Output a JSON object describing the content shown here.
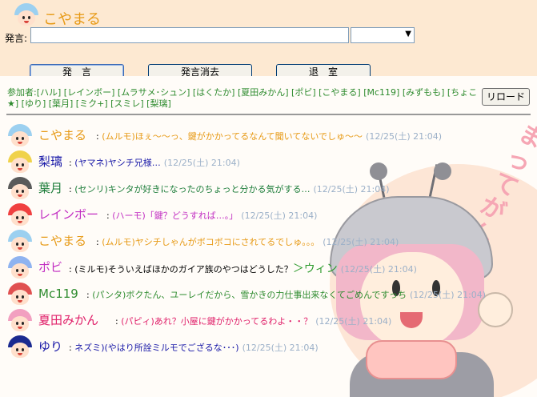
{
  "header": {
    "username": "こやまる",
    "say_label": "発言:",
    "say_input_value": "",
    "color_select_value": ""
  },
  "buttons": {
    "send": "発　言",
    "clear": "発言消去",
    "leave": "退　室",
    "reload": "リロード"
  },
  "participants": {
    "text": "参加者:[ハル] [レインボー] [ムラサメ･シュン] [はくたか] [夏田みかん] [ポビ] [こやまる] [Mc119] [みずもも] [ちょこ★] [ゆり] [葉月] [ミク+] [スミレ] [梨璃]"
  },
  "decoration": {
    "text": "まってがんばる"
  },
  "messages": [
    {
      "name": "こやまる",
      "name_color": "#e79a16",
      "text": "(ムルモ)ほぇ〜〜っ、鍵がかかってるなんて聞いてないでしゅ〜〜",
      "text_color": "#e79a16",
      "time": "(12/25(土) 21:04)"
    },
    {
      "name": "梨璃",
      "name_color": "#1a1aa8",
      "text": "(ヤマネ)ヤシチ兄様…",
      "text_color": "#1a1aa8",
      "time": "(12/25(土) 21:04)"
    },
    {
      "name": "葉月",
      "name_color": "#1d7d3a",
      "text": "(センリ)キンタが好きになったのちょっと分かる気がする…",
      "text_color": "#1d7d3a",
      "time": "(12/25(土) 21:04)"
    },
    {
      "name": "レインボー",
      "name_color": "#c22ec2",
      "text": "(ハーモ)「鍵？どうすれば…。」",
      "text_color": "#c22ec2",
      "time": "(12/25(土) 21:04)"
    },
    {
      "name": "こやまる",
      "name_color": "#e79a16",
      "text": "(ムルモ)ヤシチしゃんがボコボコにされてるでしゅ。。。",
      "text_color": "#e79a16",
      "time": "(12/25(土) 21:04)"
    },
    {
      "name": "ポビ",
      "name_color": "#c22ec2",
      "text": "(ミルモ)そういえばほかのガイア族のやつはどうした？",
      "text_color": "#000000",
      "time": "(12/25(土) 21:04)",
      "extra": "＞ウィン",
      "extra_color": "#2e9b2e"
    },
    {
      "name": "Mc119",
      "name_color": "#2e8b2e",
      "text": "(パンタ)ボクたん、ユーレイだから、雪かきの力仕事出来なくてごめんですっち",
      "text_color": "#2e8b2e",
      "time": "(12/25(土) 21:04)"
    },
    {
      "name": "夏田みかん",
      "name_color": "#e0206a",
      "text": "(パピィ)あれ？小屋に鍵がかかってるわよ・・？",
      "text_color": "#e0206a",
      "time": "(12/25(土) 21:04)"
    },
    {
      "name": "ゆり",
      "name_color": "#1a1aa8",
      "text": "ネズミ)(やはり所詮ミルモでござるな･･･)",
      "text_color": "#1a1aa8",
      "time": "(12/25(土) 21:04)"
    }
  ],
  "colors": {
    "top_bg": "#fde9d2",
    "log_bg": "#fffcf8"
  }
}
